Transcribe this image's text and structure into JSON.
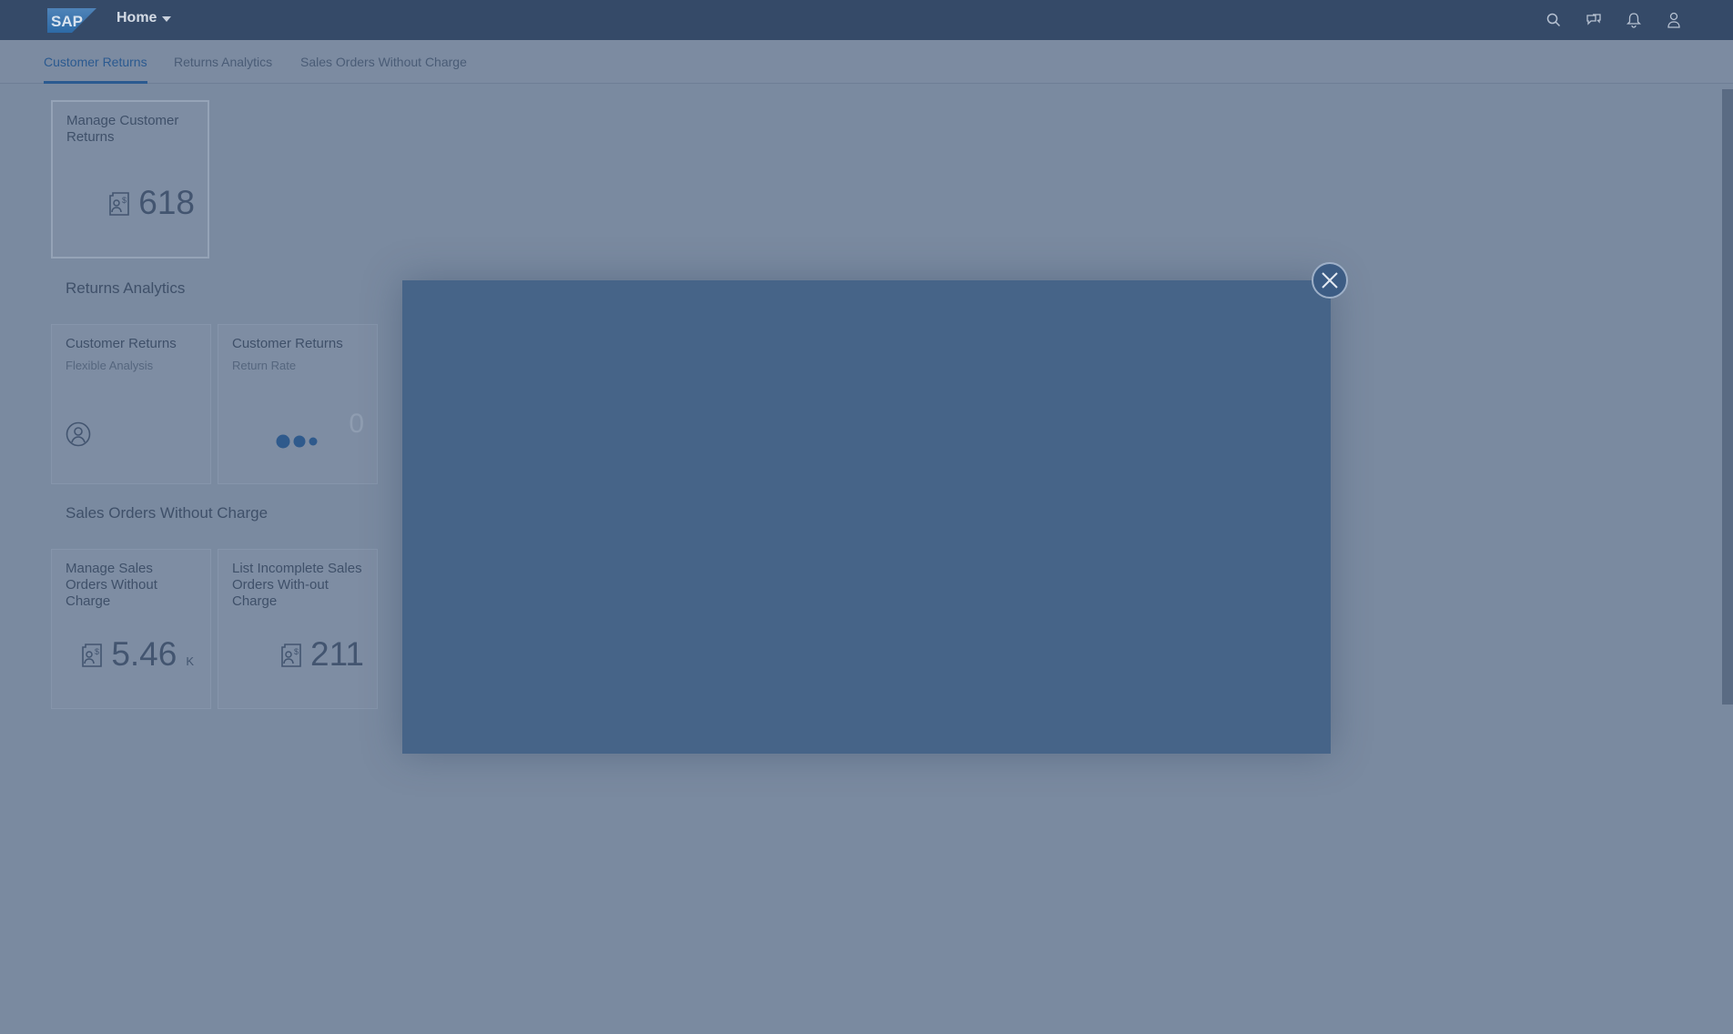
{
  "header": {
    "logo_text": "SAP",
    "home_label": "Home",
    "actions": [
      {
        "icon": "search-icon"
      },
      {
        "icon": "chat-icon"
      },
      {
        "icon": "bell-icon"
      },
      {
        "icon": "user-icon"
      }
    ]
  },
  "anchor_tabs": [
    {
      "label": "Customer Returns",
      "active": true
    },
    {
      "label": "Returns Analytics",
      "active": false
    },
    {
      "label": "Sales Orders Without Charge",
      "active": false
    }
  ],
  "groups": {
    "customer_returns": {
      "tiles": [
        {
          "title": "Manage Customer Returns",
          "value": "618",
          "icon": "document-money-icon"
        }
      ]
    },
    "returns_analytics": {
      "title": "Returns Analytics",
      "tiles": [
        {
          "title": "Customer Returns",
          "subtitle": "Flexible Analysis",
          "icon": "user-circle-icon"
        },
        {
          "title": "Customer Returns",
          "subtitle": "Return Rate",
          "value": "0",
          "icon": "loading-dots-icon"
        }
      ]
    },
    "sales_orders": {
      "title": "Sales Orders Without Charge",
      "tiles": [
        {
          "title": "Manage Sales Orders Without Charge",
          "value": "5.46",
          "unit": "K",
          "icon": "document-money-icon"
        },
        {
          "title": "List Incomplete Sales Orders With-out Charge",
          "value": "211",
          "icon": "document-money-icon"
        }
      ]
    }
  },
  "colors": {
    "shell": "#354a68",
    "overlay_bg": "#7a8aa0",
    "dialog": "#466488",
    "accent": "#2b5a90"
  }
}
